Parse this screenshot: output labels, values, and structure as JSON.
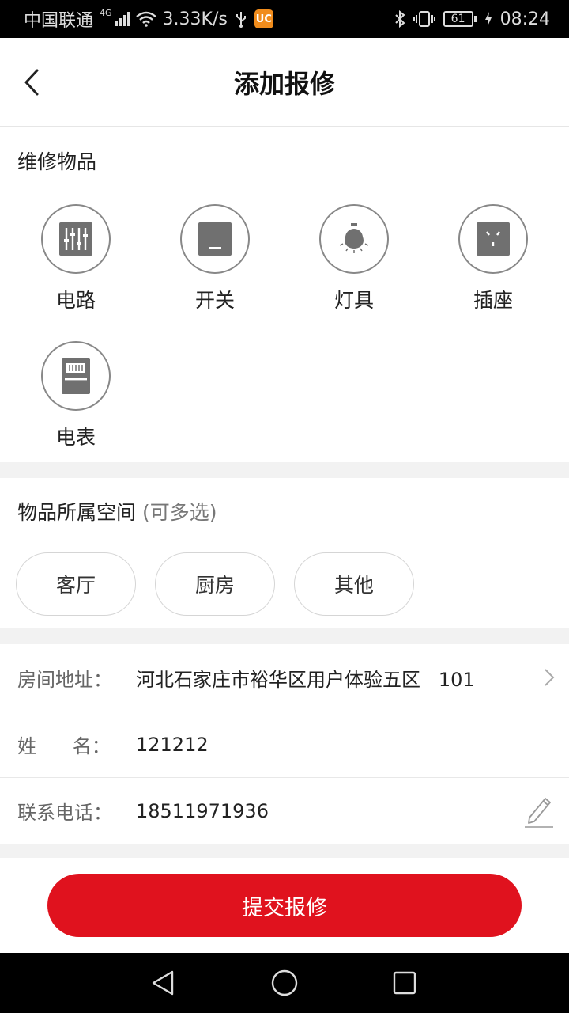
{
  "status_bar": {
    "carrier": "中国联通",
    "network_type": "4G",
    "speed": "3.33K/s",
    "battery": "61",
    "time": "08:24"
  },
  "header": {
    "title": "添加报修"
  },
  "items_section": {
    "title": "维修物品",
    "items": [
      {
        "label": "电路",
        "icon": "circuit-icon"
      },
      {
        "label": "开关",
        "icon": "switch-icon"
      },
      {
        "label": "灯具",
        "icon": "lamp-icon"
      },
      {
        "label": "插座",
        "icon": "socket-icon"
      },
      {
        "label": "电表",
        "icon": "meter-icon"
      }
    ]
  },
  "space_section": {
    "title": "物品所属空间",
    "hint": "(可多选)",
    "options": [
      "客厅",
      "厨房",
      "其他"
    ]
  },
  "info_section": {
    "address_label": "房间地址：",
    "address_value": "河北石家庄市裕华区用户体验五区   101",
    "name_label": "姓      名：",
    "name_value": "121212",
    "phone_label": "联系电话：",
    "phone_value": "18511971936"
  },
  "submit": {
    "label": "提交报修"
  },
  "colors": {
    "accent": "#e0121e",
    "icon_gray": "#707070",
    "divider": "#f2f2f2"
  }
}
